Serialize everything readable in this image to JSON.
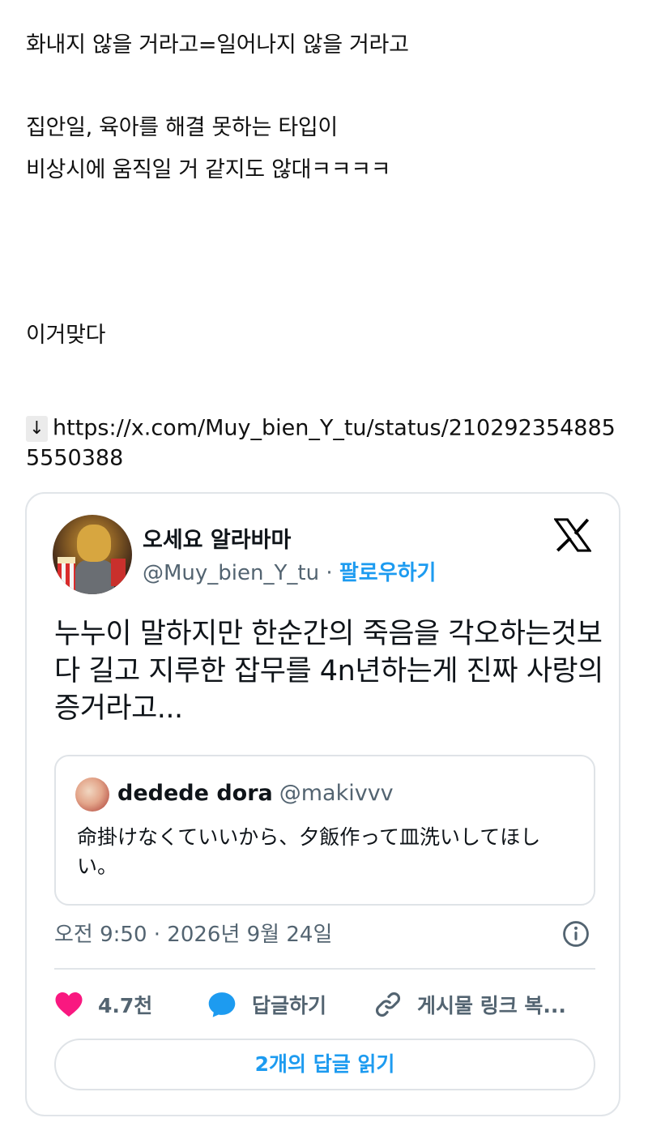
{
  "post": {
    "lines": [
      "화내지 않을 거라고=일어나지 않을 거라고",
      "집안일, 육아를 해결 못하는 타입이",
      "비상시에 움직일 거 같지도 않대ㅋㅋㅋㅋ",
      "이거맞다"
    ],
    "arrow": "↓",
    "link": "https://x.com/Muy_bien_Y_tu/status/2102923548855550388"
  },
  "tweet": {
    "display_name": "오세요 알라바마",
    "handle": "@Muy_bien_Y_tu",
    "separator": "·",
    "follow_label": "팔로우하기",
    "body": "누누이 말하지만 한순간의 죽음을 각오하는것보다 길고 지루한 잡무를 4n년하는게 진짜 사랑의 증거라고...",
    "quote": {
      "name": "dedede dora",
      "handle": "@makivvv",
      "text": "命掛けなくていいから、夕飯作って皿洗いしてほしい。"
    },
    "timestamp": "오전 9:50 · 2026년 9월 24일",
    "actions": {
      "like_count": "4.7천",
      "reply_label": "답글하기",
      "copy_label": "게시물 링크 복..."
    },
    "read_replies_label": "2개의 답글 읽기"
  },
  "icons": {
    "x_logo": "x-logo-icon",
    "info": "info-icon",
    "heart": "heart-icon",
    "reply": "reply-bubble-icon",
    "link": "link-icon"
  },
  "colors": {
    "accent_blue": "#1d9bf0",
    "heart_pink": "#f91880",
    "secondary_text": "#536471"
  }
}
